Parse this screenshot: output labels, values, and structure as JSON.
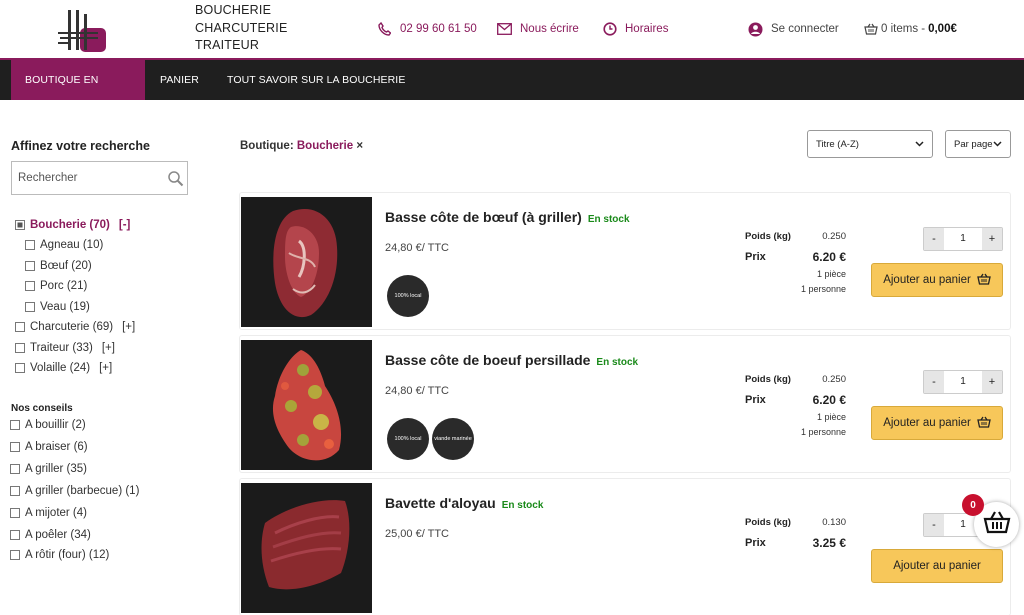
{
  "header": {
    "brand_lines": [
      "BOUCHERIE",
      "CHARCUTERIE",
      "TRAITEUR"
    ],
    "phone": "02 99 60 61 50",
    "email_label": "Nous écrire",
    "hours_label": "Horaires",
    "login_label": "Se connecter",
    "cart_items": "0 items -",
    "cart_total": "0,00€",
    "accent_color": "#8a1b5c"
  },
  "nav": {
    "items": [
      {
        "label": "BOUTIQUE EN LIGNE",
        "active": true
      },
      {
        "label": "PANIER"
      },
      {
        "label": "TOUT SAVOIR SUR LA BOUCHERIE"
      }
    ]
  },
  "sidebar": {
    "title": "Affinez votre recherche",
    "search_placeholder": "Rechercher",
    "categories": [
      {
        "label": "Boucherie (70)",
        "toggle": "[-]"
      },
      {
        "label": "Agneau (10)"
      },
      {
        "label": "Bœuf (20)"
      },
      {
        "label": "Porc (21)"
      },
      {
        "label": "Veau (19)"
      },
      {
        "label": "Charcuterie (69)",
        "toggle": "[+]"
      },
      {
        "label": "Traiteur (33)",
        "toggle": "[+]"
      },
      {
        "label": "Volaille (24)",
        "toggle": "[+]"
      }
    ],
    "tips_title": "Nos conseils",
    "tips": [
      {
        "label": "A bouillir (2)"
      },
      {
        "label": "A braiser (6)"
      },
      {
        "label": "A griller (35)"
      },
      {
        "label": "A griller (barbecue) (1)"
      },
      {
        "label": "A mijoter (4)"
      },
      {
        "label": "A poêler (34)"
      },
      {
        "label": "A rôtir (four) (12)"
      }
    ]
  },
  "main": {
    "filter_prefix": "Boutique:",
    "filter_value": "Boucherie",
    "filter_remove": "×",
    "sort_label": "Titre (A-Z)",
    "perpage_label": "Par page"
  },
  "products": [
    {
      "name": "Basse côte de bœuf (à griller)",
      "stock": "En stock",
      "price_per_kg": "24,80 €/ TTC",
      "badges": [
        "100% local"
      ],
      "weight_label": "Poids (kg)",
      "weight": "0.250",
      "price_label": "Prix",
      "price": "6.20 €",
      "pieces": "1 pièce",
      "persons": "1 personne",
      "qty": "1",
      "add_label": "Ajouter au panier"
    },
    {
      "name": "Basse côte de boeuf persillade",
      "stock": "En stock",
      "price_per_kg": "24,80 €/ TTC",
      "badges": [
        "100% local",
        "viande marinée"
      ],
      "weight_label": "Poids (kg)",
      "weight": "0.250",
      "price_label": "Prix",
      "price": "6.20 €",
      "pieces": "1 pièce",
      "persons": "1 personne",
      "qty": "1",
      "add_label": "Ajouter au panier"
    },
    {
      "name": "Bavette d'aloyau",
      "stock": "En stock",
      "price_per_kg": "25,00 €/ TTC",
      "badges": [],
      "weight_label": "Poids (kg)",
      "weight": "0.130",
      "price_label": "Prix",
      "price": "3.25 €",
      "pieces": "",
      "persons": "",
      "qty": "1",
      "add_label": "Ajouter au panier"
    }
  ],
  "float_cart": {
    "count": "0"
  }
}
